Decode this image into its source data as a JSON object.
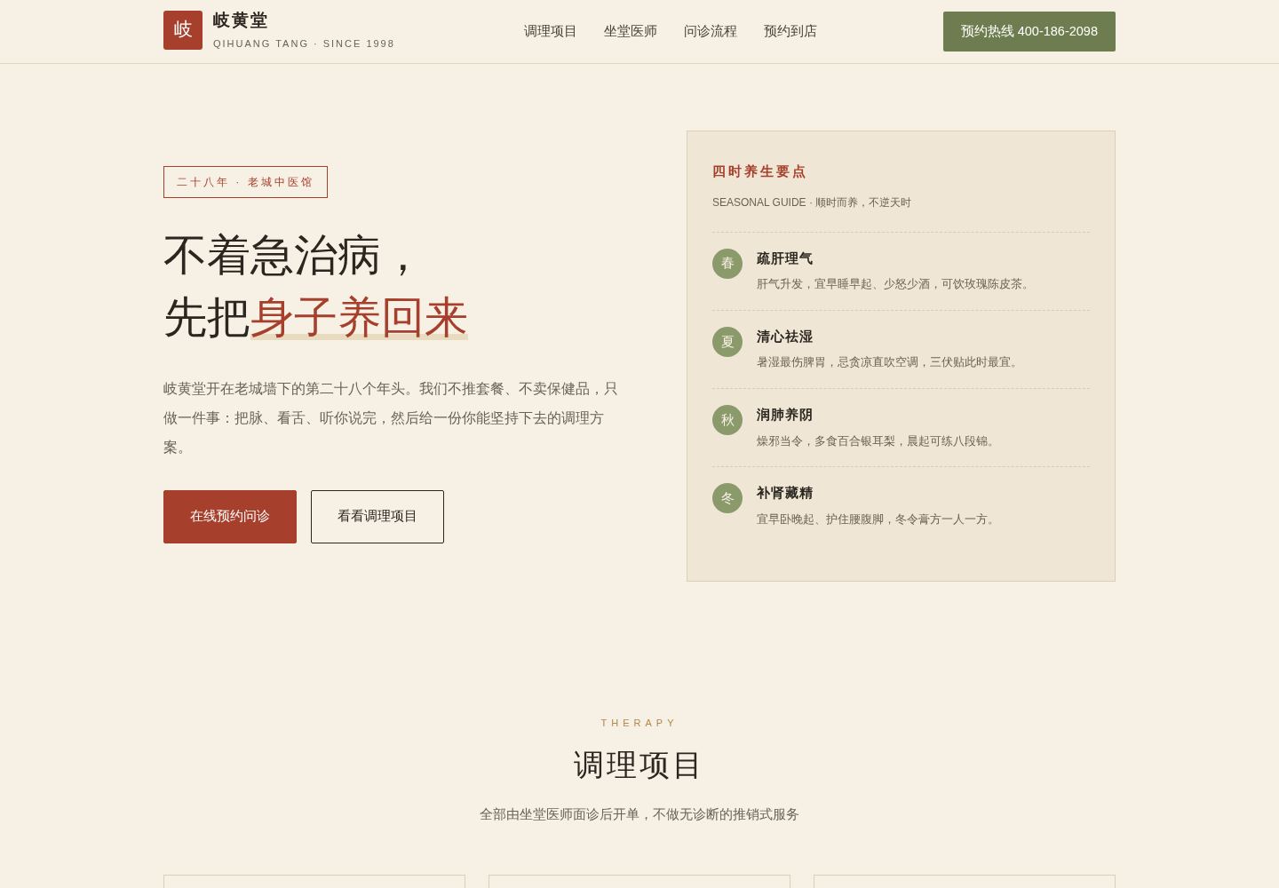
{
  "header": {
    "logo_char": "岐",
    "brand": "岐黄堂",
    "tagline": "QIHUANG TANG · SINCE 1998",
    "nav": [
      {
        "label": "调理项目"
      },
      {
        "label": "坐堂医师"
      },
      {
        "label": "问诊流程"
      },
      {
        "label": "预约到店"
      }
    ],
    "hotline": "预约热线 400-186-2098"
  },
  "hero": {
    "badge": "二十八年 · 老城中医馆",
    "title_line1": "不着急治病，",
    "title_line2_plain": "先把",
    "title_line2_accent": "身子养回来",
    "intro": "岐黄堂开在老城墙下的第二十八个年头。我们不推套餐、不卖保健品，只做一件事：把脉、看舌、听你说完，然后给一份你能坚持下去的调理方案。",
    "buttons": [
      {
        "label": "在线预约问诊",
        "kind": "primary"
      },
      {
        "label": "看看调理项目",
        "kind": "outline"
      }
    ]
  },
  "guide": {
    "title": "四时养生要点",
    "subtitle": "SEASONAL GUIDE · 顺时而养，不逆天时",
    "seasons": [
      {
        "char": "春",
        "title": "疏肝理气",
        "text": "肝气升发，宜早睡早起、少怒少酒，可饮玫瑰陈皮茶。"
      },
      {
        "char": "夏",
        "title": "清心祛湿",
        "text": "暑湿最伤脾胃，忌贪凉直吹空调，三伏贴此时最宜。"
      },
      {
        "char": "秋",
        "title": "润肺养阴",
        "text": "燥邪当令，多食百合银耳梨，晨起可练八段锦。"
      },
      {
        "char": "冬",
        "title": "补肾藏精",
        "text": "宜早卧晚起、护住腰腹脚，冬令膏方一人一方。"
      }
    ]
  },
  "therapy": {
    "eyebrow": "THERAPY",
    "title": "调理项目",
    "subtitle": "全部由坐堂医师面诊后开单，不做无诊断的推销式服务"
  }
}
